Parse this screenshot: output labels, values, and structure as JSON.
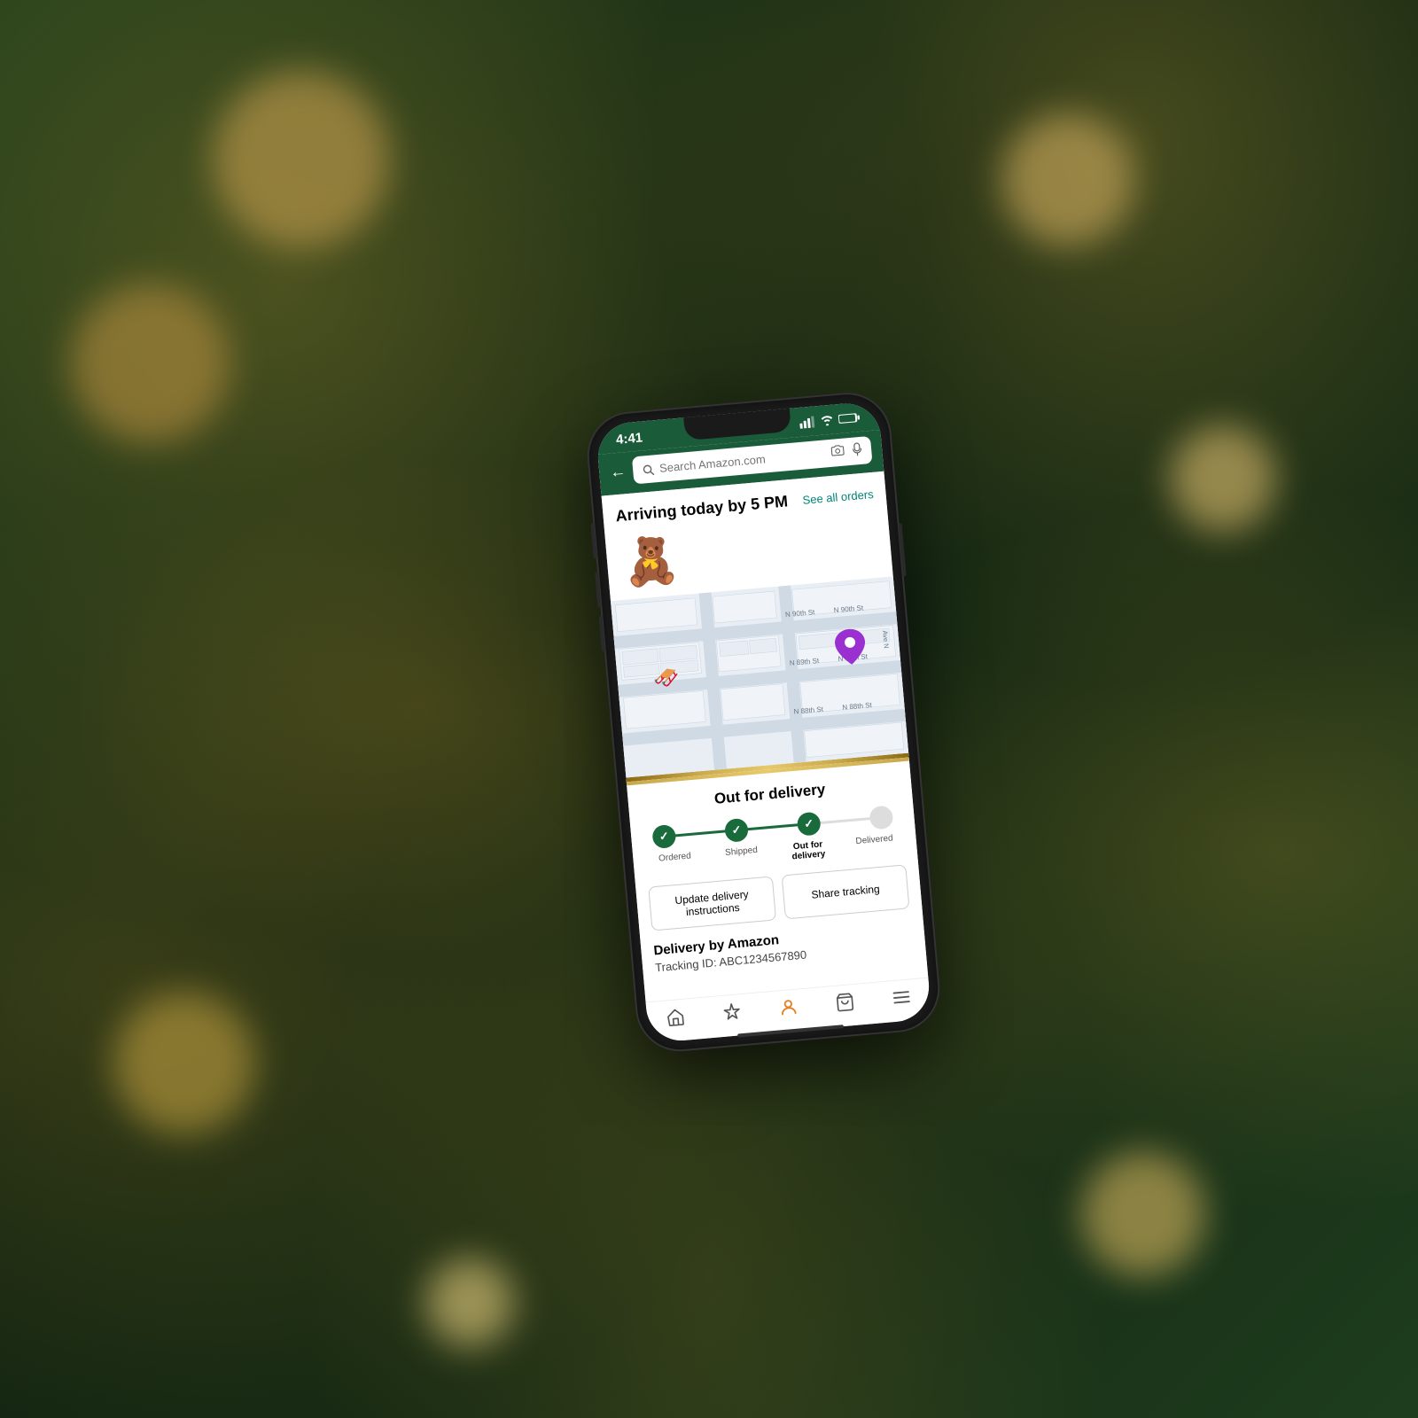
{
  "scene": {
    "background_color": "#1a3a1a"
  },
  "status_bar": {
    "time": "4:41",
    "signal": "▋▋▋",
    "wifi": "WiFi",
    "battery": "🔋"
  },
  "search": {
    "placeholder": "Search Amazon.com",
    "back_label": "←"
  },
  "order": {
    "arriving_text": "Arriving today by 5 PM",
    "see_all_label": "See all orders"
  },
  "product": {
    "emoji": "🧸"
  },
  "map": {
    "street_labels": [
      "N 90th St",
      "N 89th St",
      "N 88th St"
    ],
    "pin_emoji": "📍",
    "sleigh_emoji": "🛷"
  },
  "delivery_card": {
    "title": "Out for delivery",
    "steps": [
      {
        "label": "Ordered",
        "active": true
      },
      {
        "label": "Shipped",
        "active": true
      },
      {
        "label": "Out for delivery",
        "active": true
      },
      {
        "label": "Delivered",
        "active": false
      }
    ],
    "buttons": [
      {
        "label": "Update delivery instructions",
        "id": "update-delivery-btn"
      },
      {
        "label": "Share tracking",
        "id": "share-tracking-btn"
      }
    ],
    "delivery_by": "Delivery by Amazon",
    "tracking_label": "Tracking ID: ABC1234567890"
  },
  "bottom_nav": {
    "items": [
      {
        "icon": "🏠",
        "label": "home",
        "active": false
      },
      {
        "icon": "✦",
        "label": "spark",
        "active": false
      },
      {
        "icon": "👤",
        "label": "account",
        "active": true
      },
      {
        "icon": "🛒",
        "label": "cart",
        "active": false
      },
      {
        "icon": "☰",
        "label": "menu",
        "active": false
      }
    ]
  }
}
